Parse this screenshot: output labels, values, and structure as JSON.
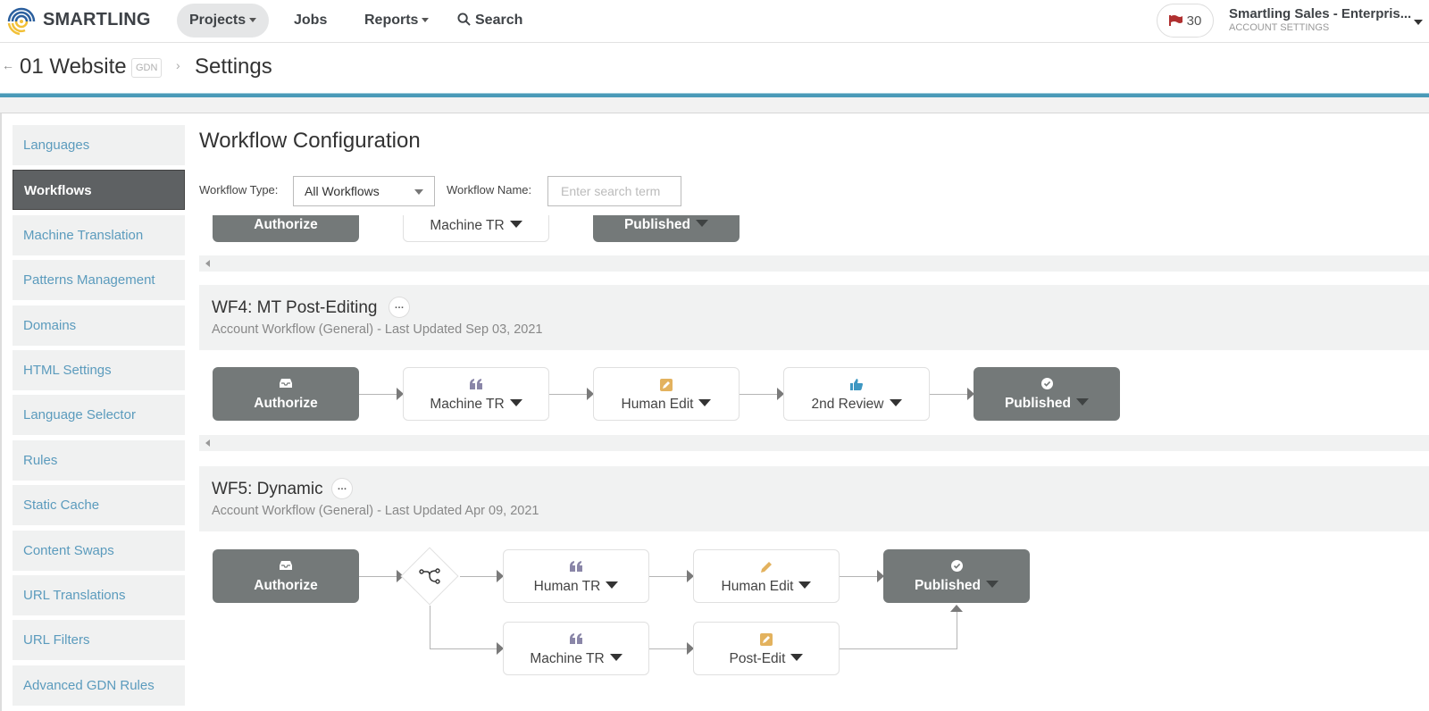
{
  "nav": {
    "brand": "SMARTLING",
    "items": [
      {
        "label": "Projects",
        "has_caret": true,
        "active": true
      },
      {
        "label": "Jobs",
        "has_caret": false,
        "active": false
      },
      {
        "label": "Reports",
        "has_caret": true,
        "active": false
      },
      {
        "label": "Search",
        "icon": "search-icon",
        "has_caret": false,
        "active": false
      }
    ],
    "issues_count": "30",
    "issues_icon": "flag-icon",
    "account_name": "Smartling Sales - Enterpris...",
    "account_sub": "ACCOUNT SETTINGS"
  },
  "breadcrumb": {
    "back_icon": "arrow-left-icon",
    "project": "01 Website",
    "badge": "GDN",
    "separator": "›",
    "page": "Settings"
  },
  "sidebar": {
    "items": [
      {
        "label": "Languages",
        "active": false
      },
      {
        "label": "Workflows",
        "active": true
      },
      {
        "label": "Machine Translation",
        "active": false
      },
      {
        "label": "Patterns Management",
        "active": false
      },
      {
        "label": "Domains",
        "active": false
      },
      {
        "label": "HTML Settings",
        "active": false
      },
      {
        "label": "Language Selector",
        "active": false
      },
      {
        "label": "Rules",
        "active": false
      },
      {
        "label": "Static Cache",
        "active": false
      },
      {
        "label": "Content Swaps",
        "active": false
      },
      {
        "label": "URL Translations",
        "active": false
      },
      {
        "label": "URL Filters",
        "active": false
      },
      {
        "label": "Advanced GDN Rules",
        "active": false
      }
    ]
  },
  "main": {
    "title": "Workflow Configuration",
    "filters": {
      "type_label": "Workflow Type:",
      "type_value": "All Workflows",
      "name_label": "Workflow Name:",
      "name_placeholder": "Enter search term",
      "name_value": ""
    },
    "partial_workflow": {
      "steps": [
        {
          "label": "Authorize",
          "style": "dark",
          "dropdown": false
        },
        {
          "label": "Machine TR",
          "style": "light",
          "dropdown": true
        },
        {
          "label": "Published",
          "style": "dark",
          "dropdown": true
        }
      ]
    },
    "workflows": [
      {
        "name": "WF4: MT Post-Editing",
        "meta": "Account Workflow (General) - Last Updated Sep 03, 2021",
        "more_icon": "ellipsis-icon",
        "steps": [
          {
            "label": "Authorize",
            "style": "dark",
            "icon": "inbox-icon",
            "dropdown": false
          },
          {
            "label": "Machine TR",
            "style": "light",
            "icon": "quote-icon",
            "icon_color": "#8a86a8",
            "dropdown": true
          },
          {
            "label": "Human Edit",
            "style": "light",
            "icon": "edit-square-icon",
            "icon_color": "#e3b25e",
            "dropdown": true
          },
          {
            "label": "2nd Review",
            "style": "light",
            "icon": "thumbs-up-icon",
            "icon_color": "#3e97c2",
            "dropdown": true
          },
          {
            "label": "Published",
            "style": "dark",
            "icon": "check-circle-icon",
            "dropdown": true
          }
        ]
      },
      {
        "name": "WF5: Dynamic",
        "meta": "Account Workflow (General) - Last Updated Apr 09, 2021",
        "more_icon": "ellipsis-icon",
        "gate_icon": "branch-icon",
        "steps": [
          {
            "label": "Authorize",
            "style": "dark",
            "icon": "inbox-icon",
            "dropdown": false
          },
          {
            "label": "Human TR",
            "style": "light",
            "icon": "quote-icon",
            "icon_color": "#8a86a8",
            "dropdown": true
          },
          {
            "label": "Human Edit",
            "style": "light",
            "icon": "pencil-icon",
            "icon_color": "#e3b25e",
            "dropdown": true
          },
          {
            "label": "Published",
            "style": "dark",
            "icon": "check-circle-icon",
            "dropdown": true
          },
          {
            "label": "Machine TR",
            "style": "light",
            "icon": "quote-icon",
            "icon_color": "#8a86a8",
            "dropdown": true
          },
          {
            "label": "Post-Edit",
            "style": "light",
            "icon": "edit-square-icon",
            "icon_color": "#e3b25e",
            "dropdown": true
          }
        ]
      }
    ]
  },
  "colors": {
    "accent": "#4a9ab8",
    "sidebar_link": "#5b9bbd",
    "step_dark": "#747979",
    "sidebar_active": "#5e6163"
  }
}
